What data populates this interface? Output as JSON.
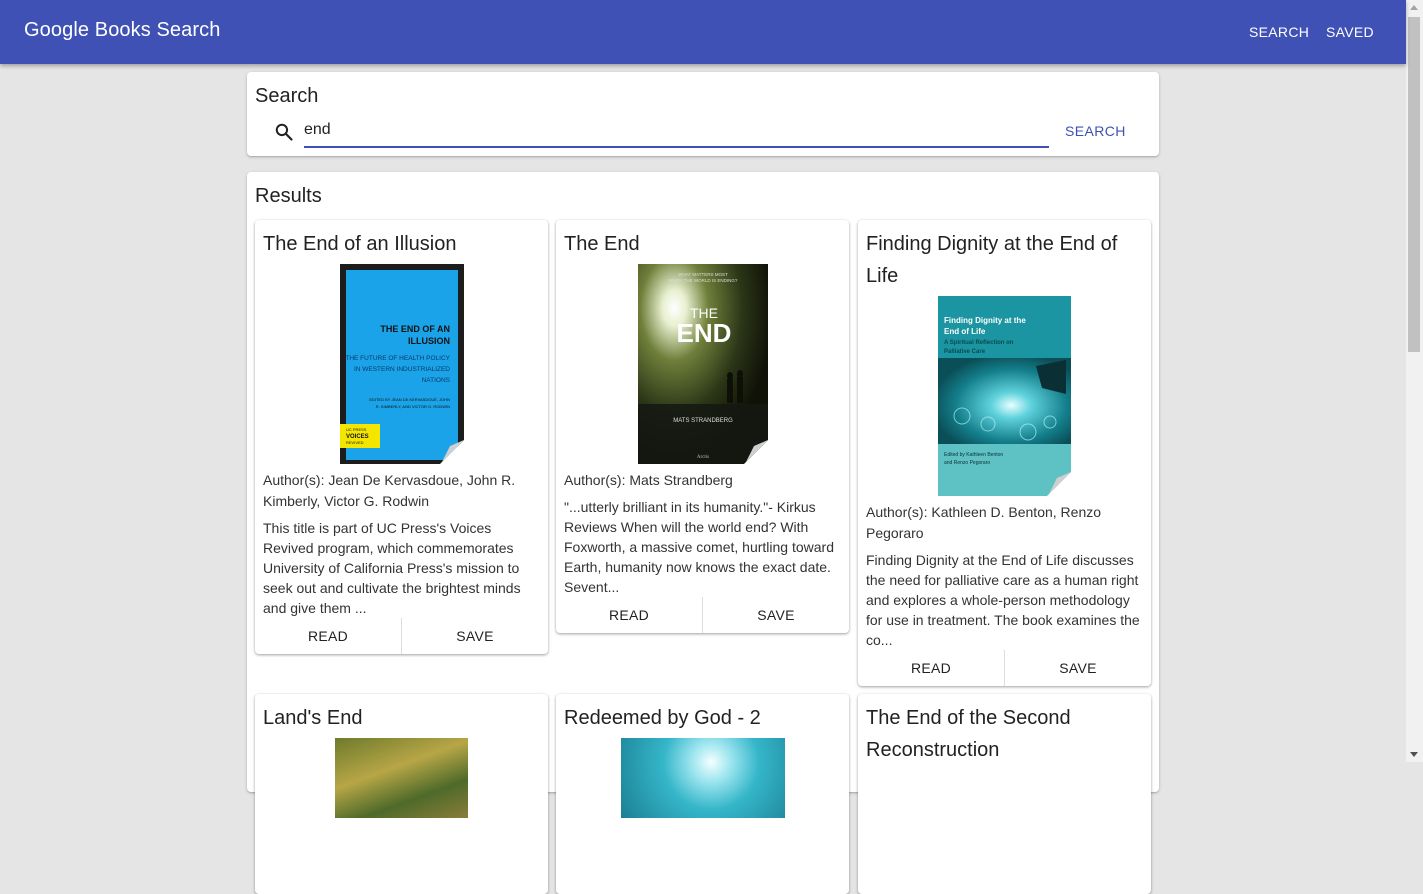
{
  "app": {
    "title": "Google Books Search",
    "nav": [
      "SEARCH",
      "SAVED"
    ],
    "brand_color": "#3f51b5"
  },
  "search": {
    "heading": "Search",
    "value": "end",
    "button": "SEARCH",
    "icon": "search-icon"
  },
  "results": {
    "heading": "Results",
    "read_label": "READ",
    "save_label": "SAVE",
    "books": [
      {
        "title": "The End of an Illusion",
        "authors": "Author(s): Jean De Kervasdoue, John R. Kimberly, Victor G. Rodwin",
        "description": "This title is part of UC Press's Voices Revived program, which commemorates University of California Press's mission to seek out and cultivate the brightest minds and give them ...",
        "cover": {
          "line1": "THE END OF AN",
          "line2": "ILLUSION",
          "sub1": "THE FUTURE OF HEALTH POLICY",
          "sub2": "IN WESTERN INDUSTRIALIZED",
          "sub3": "NATIONS",
          "ed1": "EDITED BY JEAN DE KERVASDOUÉ, JOHN",
          "ed2": "R. KIMBERLY, AND VICTOR G. RODWIN",
          "badge1": "UC PRESS",
          "badge2": "VOICES",
          "badge3": "REVIVED"
        }
      },
      {
        "title": "The End",
        "authors": "Author(s): Mats Strandberg",
        "description": "\"...utterly brilliant in its humanity.\"- Kirkus Reviews When will the world end? With Foxworth, a massive comet, hurtling toward Earth, humanity now knows the exact date. Sevent...",
        "cover": {
          "tag1": "WHAT MATTERS MOST",
          "tag2": "WHEN THE WORLD IS ENDING?",
          "word1": "THE",
          "word2": "END",
          "author": "MATS STRANDBERG",
          "publisher": "Arctis"
        }
      },
      {
        "title": "Finding Dignity at the End of Life",
        "authors": "Author(s): Kathleen D. Benton, Renzo Pegoraro",
        "description": "Finding Dignity at the End of Life discusses the need for palliative care as a human right and explores a whole-person methodology for use in treatment. The book examines the co...",
        "cover": {
          "t1": "Finding Dignity at the",
          "t2": "End of Life",
          "s1": "A Spiritual Reflection on",
          "s2": "Palliative Care",
          "e1": "Edited by Kathleen Benton",
          "e2": "and Renzo Pegoraro"
        }
      },
      {
        "title": "Land's End"
      },
      {
        "title": "Redeemed by God - 2"
      },
      {
        "title": "The End of the Second Reconstruction"
      }
    ]
  }
}
